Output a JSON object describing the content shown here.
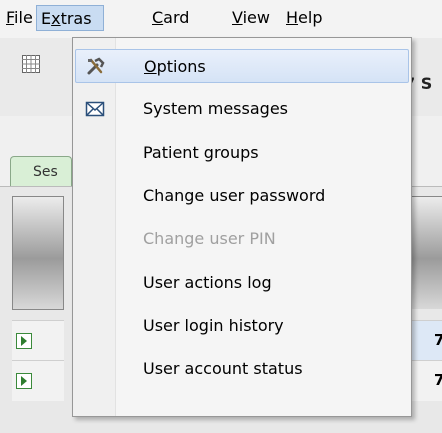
{
  "menubar": {
    "items": [
      {
        "label": "File",
        "mnemonic": "F",
        "rest": "ile"
      },
      {
        "label": "Extras",
        "mnemonic": "x",
        "pre": "E",
        "rest": "tras"
      },
      {
        "label": "Card",
        "mnemonic": "C",
        "rest": "ard"
      },
      {
        "label": "View",
        "mnemonic": "V",
        "rest": "iew"
      },
      {
        "label": "Help",
        "mnemonic": "H",
        "rest": "elp"
      }
    ]
  },
  "background": {
    "tab_label": "Ses",
    "toolbar_text": "7 S",
    "row_values": [
      "7",
      "7"
    ]
  },
  "extras_menu": {
    "items": [
      {
        "label": "Options",
        "mnemonic": "O",
        "rest": "ptions",
        "icon": "tools-icon",
        "highlighted": true,
        "enabled": true
      },
      {
        "label": "System messages",
        "icon": "envelope-icon",
        "enabled": true
      },
      {
        "label": "Patient groups",
        "enabled": true
      },
      {
        "label": "Change user password",
        "enabled": true
      },
      {
        "label": "Change user PIN",
        "enabled": false
      },
      {
        "label": "User actions log",
        "enabled": true
      },
      {
        "label": "User login history",
        "enabled": true
      },
      {
        "label": "User account status",
        "enabled": true
      }
    ]
  },
  "colors": {
    "menu_highlight": "#d5e3f6",
    "menubar_active": "#c9dcf2",
    "disabled_text": "#a0a0a0",
    "accent_green": "#2e7d2e"
  }
}
